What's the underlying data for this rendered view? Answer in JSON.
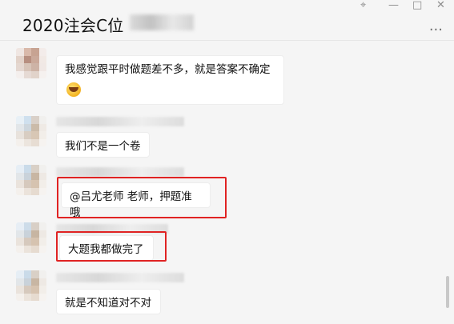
{
  "header": {
    "title": "2020注会C位",
    "controls": [
      "pin-icon",
      "minimize-icon",
      "maximize-icon",
      "close-icon"
    ],
    "more": "..."
  },
  "messages": [
    {
      "text": "我感觉跟平时做题差不多，就是答案不确定",
      "emoji": "laughing-face-icon"
    },
    {
      "text": "我们不是一个卷"
    },
    {
      "text": "@吕尤老师 老师，押题准哦",
      "highlighted": true
    },
    {
      "text": "大题我都做完了",
      "highlighted": true
    },
    {
      "text": "就是不知道对不对"
    }
  ],
  "colors": {
    "highlight": "#e02323",
    "background": "#f5f5f5",
    "bubble": "#ffffff"
  }
}
